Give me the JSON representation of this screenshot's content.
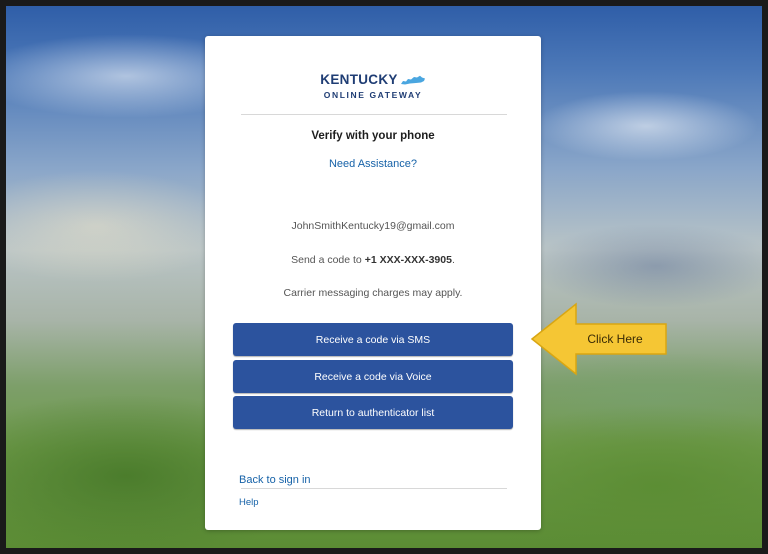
{
  "brand": {
    "title": "KENTUCKY",
    "subtitle": "ONLINE GATEWAY"
  },
  "card": {
    "heading": "Verify with your phone",
    "assist_link": "Need Assistance?",
    "email": "JohnSmithKentucky19@gmail.com",
    "send_prefix": "Send a code to ",
    "phone": "+1 XXX-XXX-3905",
    "send_suffix": ".",
    "carrier_note": "Carrier messaging charges may apply."
  },
  "buttons": {
    "sms": "Receive a code via SMS",
    "voice": "Receive a code via Voice",
    "return": "Return to authenticator list"
  },
  "footer": {
    "back_link": "Back to sign in",
    "help_link": "Help"
  },
  "annotation": {
    "label": "Click Here",
    "color": "#f5c634"
  },
  "colors": {
    "button": "#2c539e",
    "link": "#1662a8",
    "brand": "#1f3d74"
  }
}
